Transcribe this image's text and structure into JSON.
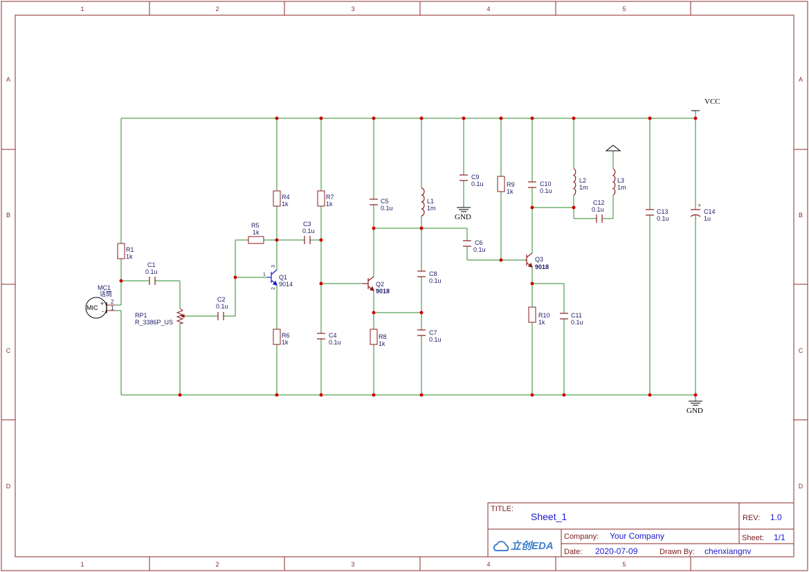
{
  "frame": {
    "columns": [
      "1",
      "2",
      "3",
      "4",
      "5"
    ],
    "rows": [
      "A",
      "B",
      "C",
      "D"
    ]
  },
  "power": {
    "vcc": "VCC",
    "gnd": "GND"
  },
  "components": {
    "r1": {
      "ref": "R1",
      "value": "1k"
    },
    "r4": {
      "ref": "R4",
      "value": "1k"
    },
    "r5": {
      "ref": "R5",
      "value": "1k"
    },
    "r6": {
      "ref": "R6",
      "value": "1k"
    },
    "r7": {
      "ref": "R7",
      "value": "1k"
    },
    "r8": {
      "ref": "R8",
      "value": "1k"
    },
    "r9": {
      "ref": "R9",
      "value": "1k"
    },
    "r10": {
      "ref": "R10",
      "value": "1k"
    },
    "c1": {
      "ref": "C1",
      "value": "0.1u"
    },
    "c2": {
      "ref": "C2",
      "value": "0.1u"
    },
    "c3": {
      "ref": "C3",
      "value": "0.1u"
    },
    "c4": {
      "ref": "C4",
      "value": "0.1u"
    },
    "c5": {
      "ref": "C5",
      "value": "0.1u"
    },
    "c6": {
      "ref": "C6",
      "value": "0.1u"
    },
    "c7": {
      "ref": "C7",
      "value": "0.1u"
    },
    "c8": {
      "ref": "C8",
      "value": "0.1u"
    },
    "c9": {
      "ref": "C9",
      "value": "0.1u"
    },
    "c10": {
      "ref": "C10",
      "value": "0.1u"
    },
    "c11": {
      "ref": "C11",
      "value": "0.1u"
    },
    "c12": {
      "ref": "C12",
      "value": "0.1u"
    },
    "c13": {
      "ref": "C13",
      "value": "0.1u"
    },
    "c14": {
      "ref": "C14",
      "value": "1u"
    },
    "l1": {
      "ref": "L1",
      "value": "1m"
    },
    "l2": {
      "ref": "L2",
      "value": "1m"
    },
    "l3": {
      "ref": "L3",
      "value": "1m"
    },
    "q1": {
      "ref": "Q1",
      "value": "9014"
    },
    "q2": {
      "ref": "Q2",
      "value": "9018"
    },
    "q3": {
      "ref": "Q3",
      "value": "9018"
    },
    "rp1": {
      "ref": "RP1",
      "value": "R_3386P_US"
    },
    "mc1": {
      "ref": "MC1",
      "value": "话筒",
      "body": "MIC",
      "pin_plus": "+",
      "pin_minus": "-",
      "pin2": "2",
      "pin1": "1"
    },
    "q1pins": {
      "p1": "1",
      "p2": "2",
      "p3": "3"
    }
  },
  "title_block": {
    "title_key": "TITLE:",
    "title": "Sheet_1",
    "rev_key": "REV:",
    "rev": "1.0",
    "company_key": "Company:",
    "company": "Your Company",
    "sheet_key": "Sheet:",
    "sheet": "1/1",
    "date_key": "Date:",
    "date": "2020-07-09",
    "drawn_key": "Drawn By:",
    "drawn": "chenxiangnv",
    "logo": "立创EDA"
  },
  "colors": {
    "frame": "#8a2a2a",
    "wire": "#2a8a2a",
    "symbol": "#8a1a1a",
    "junction": "#cc0000",
    "text": "#1a1a66",
    "title": "#1a1acc"
  }
}
